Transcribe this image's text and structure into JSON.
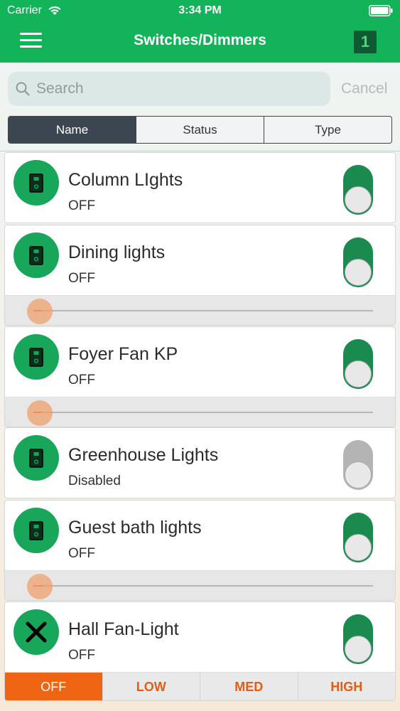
{
  "status_bar": {
    "carrier": "Carrier",
    "time": "3:34 PM"
  },
  "header": {
    "title": "Switches/Dimmers",
    "badge": "1"
  },
  "search": {
    "placeholder": "Search",
    "cancel_label": "Cancel"
  },
  "tabs": [
    {
      "label": "Name",
      "active": true
    },
    {
      "label": "Status",
      "active": false
    },
    {
      "label": "Type",
      "active": false
    }
  ],
  "devices": [
    {
      "name": "Column LIghts",
      "status": "OFF",
      "icon": "wall-switch-icon",
      "toggle": "off",
      "control": "none"
    },
    {
      "name": "Dining lights",
      "status": "OFF",
      "icon": "wall-switch-icon",
      "toggle": "off",
      "control": "dimmer",
      "level": 0
    },
    {
      "name": "Foyer Fan KP",
      "status": "OFF",
      "icon": "wall-switch-icon",
      "toggle": "off",
      "control": "dimmer",
      "level": 0
    },
    {
      "name": "Greenhouse Lights",
      "status": "Disabled",
      "icon": "wall-switch-icon",
      "toggle": "disabled",
      "control": "none"
    },
    {
      "name": "Guest bath lights",
      "status": "OFF",
      "icon": "wall-switch-icon",
      "toggle": "off",
      "control": "dimmer",
      "level": 0
    },
    {
      "name": "Hall Fan-Light",
      "status": "OFF",
      "icon": "fan-icon",
      "toggle": "off",
      "control": "fan",
      "fan_speeds": [
        "OFF",
        "LOW",
        "MED",
        "HIGH"
      ],
      "fan_selected": "OFF"
    }
  ],
  "colors": {
    "header_green": "#13b35a",
    "toggle_on_track": "#1a8a4f",
    "accent_orange": "#ef6412",
    "segment_dark": "#3b4651"
  }
}
